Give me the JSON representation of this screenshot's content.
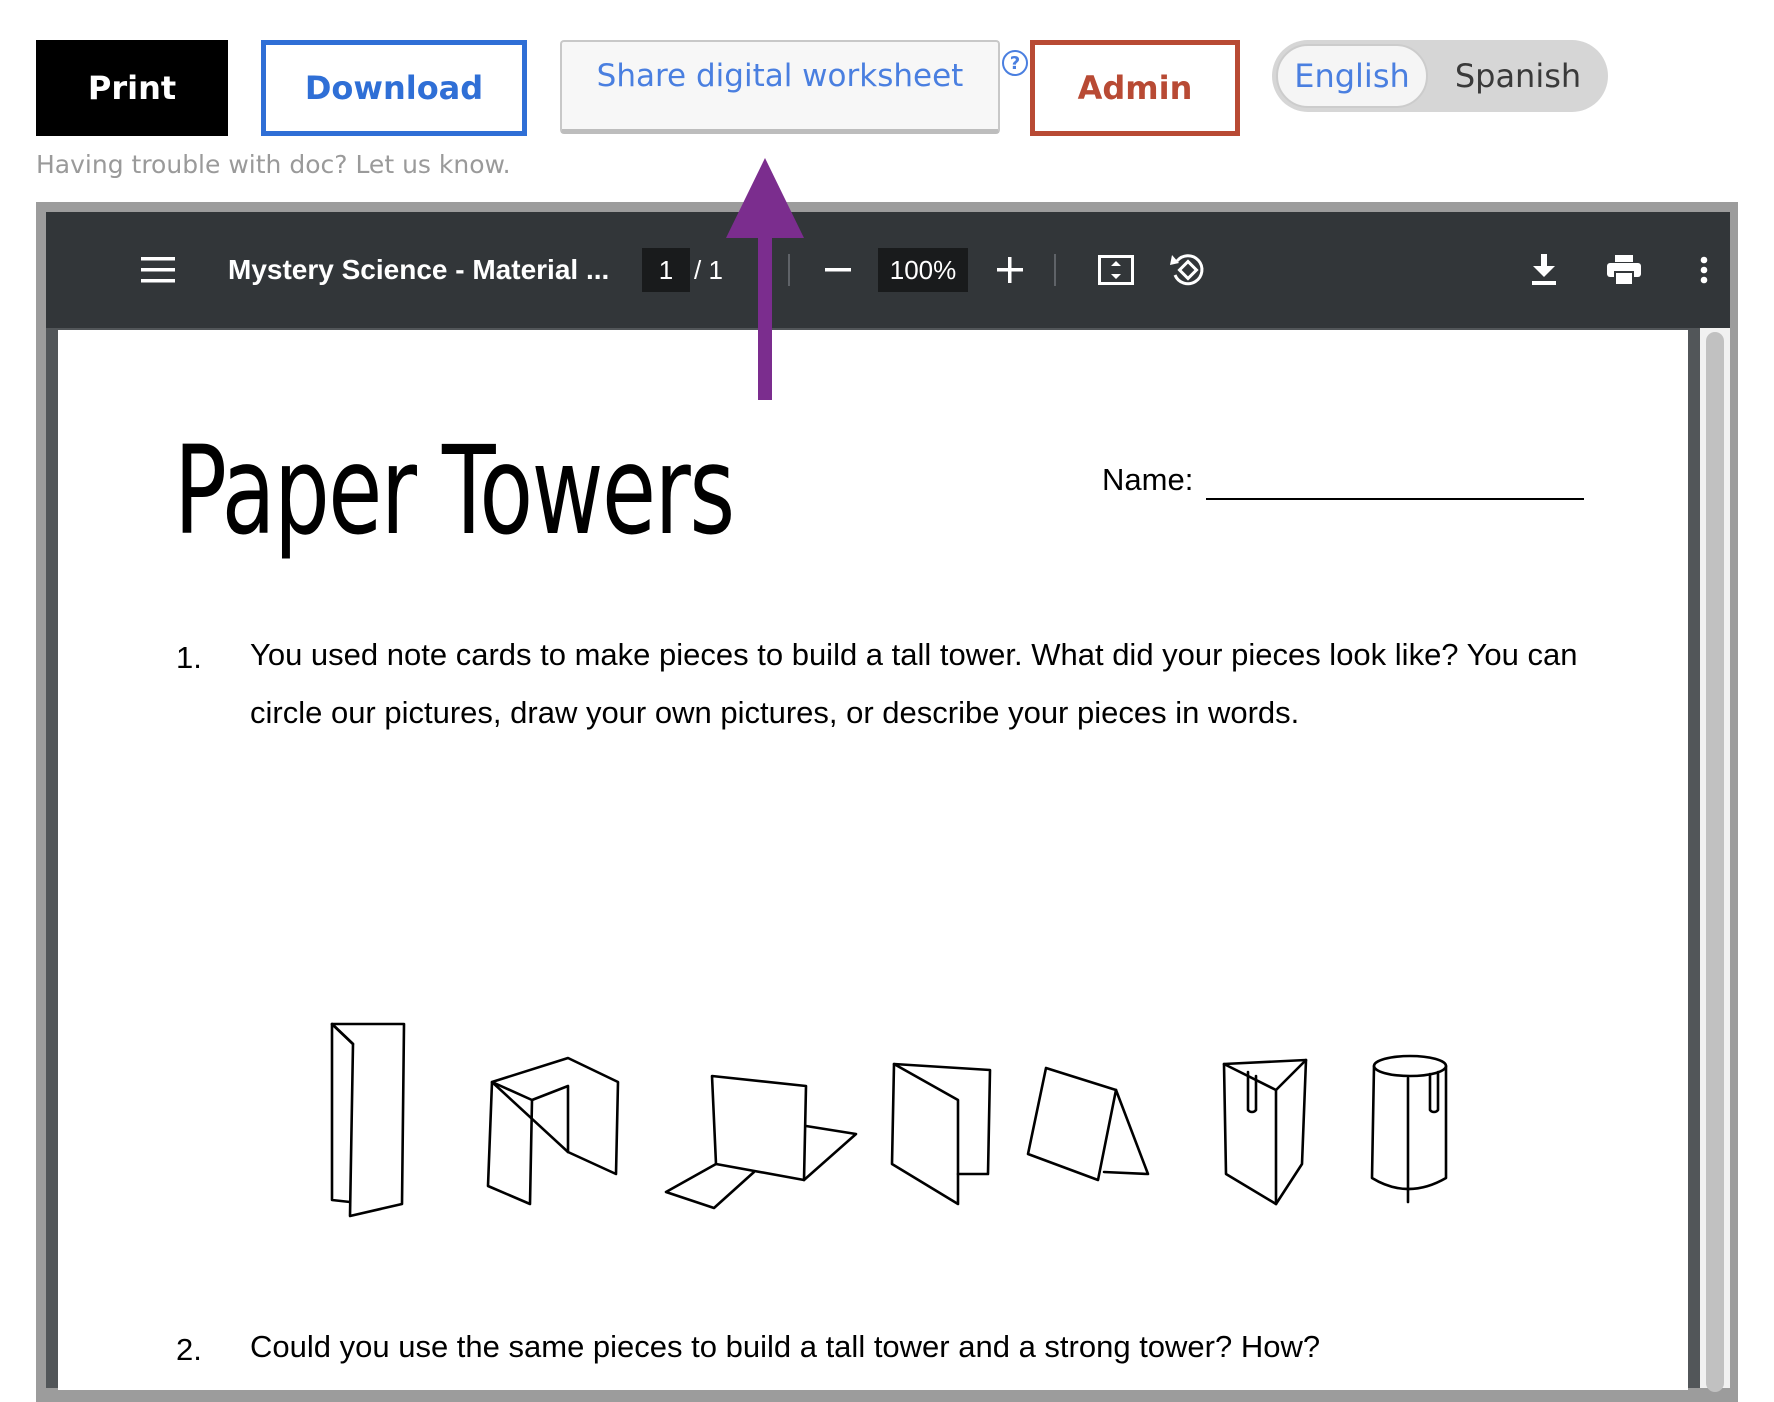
{
  "toolbar": {
    "print_label": "Print",
    "download_label": "Download",
    "share_label": "Share digital worksheet",
    "help_icon": "?",
    "admin_label": "Admin",
    "languages": [
      "English",
      "Spanish"
    ],
    "selected_language": "English",
    "trouble_text": "Having trouble with doc? Let us know."
  },
  "viewer": {
    "doc_title": "Mystery Science - Material ...",
    "current_page": "1",
    "page_separator": "/  1",
    "zoom": "100%",
    "icons": [
      "menu-icon",
      "zoom-out-icon",
      "zoom-in-icon",
      "fit-page-icon",
      "rotate-icon",
      "download-icon",
      "print-icon",
      "more-icon"
    ]
  },
  "document": {
    "title": "Paper Towers",
    "name_label": "Name:",
    "questions": [
      {
        "number": "1.",
        "text": "You used note cards to make pieces to build a tall tower. What did your pieces look like? You can circle our pictures, draw your own pictures, or describe your pieces in words."
      },
      {
        "number": "2.",
        "text": "Could you use the same pieces to build a tall tower and a strong tower? How?"
      }
    ]
  },
  "colors": {
    "download": "#2f6fd6",
    "admin": "#b84a34",
    "share_text": "#4a7fe0",
    "viewer_toolbar": "#323639",
    "annotation_arrow": "#7b2d8e"
  }
}
